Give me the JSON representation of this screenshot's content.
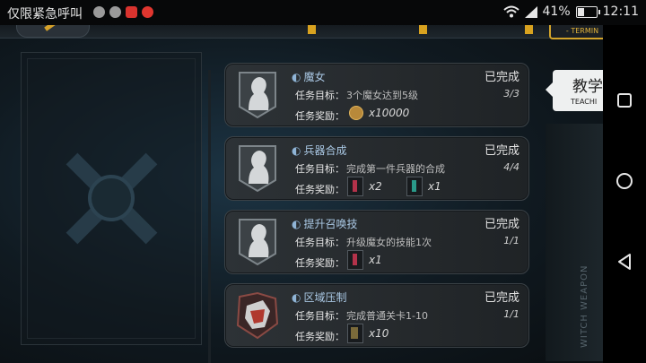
{
  "status_bar": {
    "carrier": "仅限紧急呼叫",
    "battery": "41%",
    "battery_level": 0.41,
    "time": "12:11"
  },
  "top_bar": {
    "terminal_label": "- TERMIN"
  },
  "teaching_tab": {
    "cn": "教学",
    "en": "TEACHI"
  },
  "side_label": "WITCH WEAPON",
  "tasks": [
    {
      "title": "魔女",
      "status": "已完成",
      "goal_label": "任务目标：",
      "goal": "3个魔女达到5级",
      "progress": "3/3",
      "reward_label": "任务奖励：",
      "rewards": [
        {
          "icon": "coin-icon",
          "qty": "x10000"
        }
      ]
    },
    {
      "title": "兵器合成",
      "status": "已完成",
      "goal_label": "任务目标：",
      "goal": "完成第一件兵器的合成",
      "progress": "4/4",
      "reward_label": "任务奖励：",
      "rewards": [
        {
          "icon": "red-potion-icon",
          "qty": "x2"
        },
        {
          "icon": "green-potion-icon",
          "qty": "x1"
        }
      ]
    },
    {
      "title": "提升召唤技",
      "status": "已完成",
      "goal_label": "任务目标：",
      "goal": "升级魔女的技能1次",
      "progress": "1/1",
      "reward_label": "任务奖励：",
      "rewards": [
        {
          "icon": "red-potion-icon",
          "qty": "x1"
        }
      ]
    },
    {
      "title": "区域压制",
      "status": "已完成",
      "goal_label": "任务目标：",
      "goal": "完成普通关卡1-10",
      "progress": "1/1",
      "reward_label": "任务奖励：",
      "rewards": [
        {
          "icon": "crate-icon",
          "qty": "x10"
        }
      ]
    }
  ]
}
